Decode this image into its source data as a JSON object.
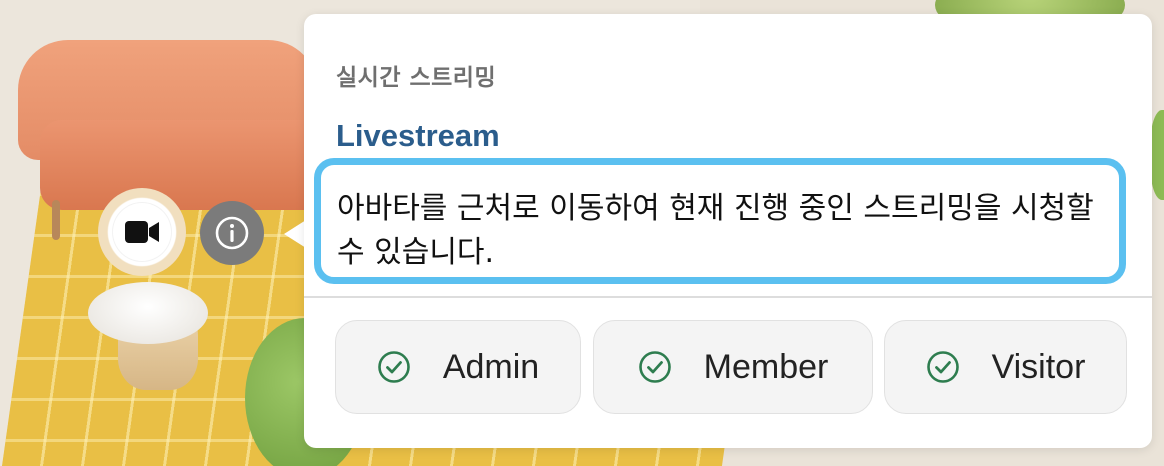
{
  "popover": {
    "subtitle": "실시간 스트리밍",
    "title": "Livestream",
    "description": "아바타를 근처로 이동하여 현재 진행 중인 스트리밍을 시청할 수 있습니다.",
    "roles": [
      {
        "label": "Admin",
        "icon": "check-circle-icon",
        "checked": true
      },
      {
        "label": "Member",
        "icon": "check-circle-icon",
        "checked": true
      },
      {
        "label": "Visitor",
        "icon": "check-circle-icon",
        "checked": true
      }
    ]
  },
  "scene": {
    "object_icon": "video-camera-icon",
    "info_icon": "info-icon"
  },
  "colors": {
    "title": "#2b5d8c",
    "highlight_border": "#5bc0f0",
    "check": "#2e7d4f",
    "info_button": "#7b7b7b"
  }
}
